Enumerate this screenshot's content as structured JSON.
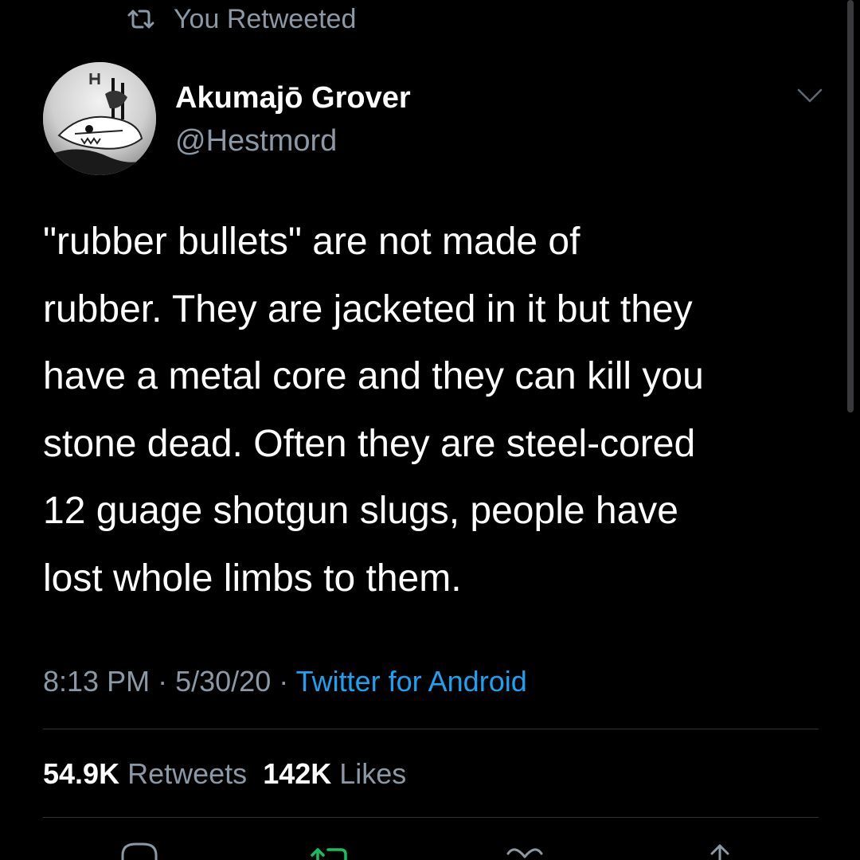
{
  "context": {
    "label": "You Retweeted"
  },
  "author": {
    "display_name": "Akumajō Grover",
    "handle": "@Hestmord"
  },
  "tweet": {
    "text_lines": [
      "\"rubber bullets\" are not made of",
      "rubber. They are jacketed in it but they",
      "have a metal core and they can kill you",
      "stone dead. Often they are steel-cored",
      "12 guage shotgun slugs, people have",
      "lost whole limbs to them."
    ]
  },
  "meta": {
    "time": "8:13 PM",
    "date": "5/30/20",
    "source": "Twitter for Android",
    "separator": "·"
  },
  "stats": {
    "retweets_count": "54.9K",
    "retweets_label": "Retweets",
    "likes_count": "142K",
    "likes_label": "Likes"
  },
  "colors": {
    "background": "#000000",
    "text_primary": "#ffffff",
    "text_secondary": "#8b98a5",
    "link": "#1da1f2",
    "retweet_active": "#17bf63",
    "divider": "#2f3336"
  },
  "icons": {
    "context": "retweet-icon",
    "menu": "chevron-down-icon",
    "actions": [
      "reply-icon",
      "retweet-icon",
      "like-icon",
      "share-icon"
    ]
  }
}
